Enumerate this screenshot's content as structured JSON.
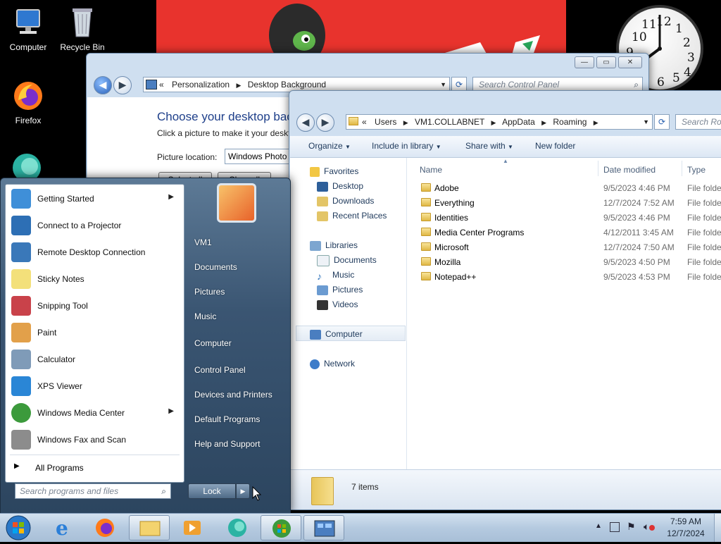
{
  "desktop": {
    "icons": [
      {
        "label": "Computer"
      },
      {
        "label": "Recycle Bin"
      },
      {
        "label": "Firefox"
      }
    ],
    "clock_numbers": [
      "12",
      "1",
      "2",
      "3",
      "4",
      "5",
      "6",
      "9",
      "10",
      "11"
    ]
  },
  "control_panel": {
    "breadcrumb_sep": "«",
    "breadcrumb": [
      "Personalization",
      "Desktop Background"
    ],
    "search_placeholder": "Search Control Panel",
    "heading": "Choose your desktop background",
    "subtext": "Click a picture to make it your desktop background",
    "picture_location_label": "Picture location:",
    "picture_location_value": "Windows Photo Viewer",
    "select_all": "Select all",
    "clear_all": "Clear all"
  },
  "explorer": {
    "breadcrumb_sep": "«",
    "breadcrumb": [
      "Users",
      "VM1.COLLABNET",
      "AppData",
      "Roaming"
    ],
    "search_placeholder": "Search Roaming",
    "toolbar": {
      "organize": "Organize",
      "include": "Include in library",
      "share": "Share with",
      "new_folder": "New folder"
    },
    "nav": {
      "favorites": "Favorites",
      "desktop": "Desktop",
      "downloads": "Downloads",
      "recent": "Recent Places",
      "libraries": "Libraries",
      "documents": "Documents",
      "music": "Music",
      "pictures": "Pictures",
      "videos": "Videos",
      "computer": "Computer",
      "network": "Network"
    },
    "columns": {
      "name": "Name",
      "date": "Date modified",
      "type": "Type"
    },
    "rows": [
      {
        "name": "Adobe",
        "date": "9/5/2023 4:46 PM",
        "type": "File folder"
      },
      {
        "name": "Everything",
        "date": "12/7/2024 7:52 AM",
        "type": "File folder"
      },
      {
        "name": "Identities",
        "date": "9/5/2023 4:46 PM",
        "type": "File folder"
      },
      {
        "name": "Media Center Programs",
        "date": "4/12/2011 3:45 AM",
        "type": "File folder"
      },
      {
        "name": "Microsoft",
        "date": "12/7/2024 7:50 AM",
        "type": "File folder"
      },
      {
        "name": "Mozilla",
        "date": "9/5/2023 4:50 PM",
        "type": "File folder"
      },
      {
        "name": "Notepad++",
        "date": "9/5/2023 4:53 PM",
        "type": "File folder"
      }
    ],
    "status_count": "7 items"
  },
  "start_menu": {
    "programs": [
      {
        "label": "Getting Started",
        "submenu": true,
        "color": "#3f8fd8"
      },
      {
        "label": "Connect to a Projector",
        "submenu": false,
        "color": "#2d6fb5"
      },
      {
        "label": "Remote Desktop Connection",
        "submenu": false,
        "color": "#3a78b9"
      },
      {
        "label": "Sticky Notes",
        "submenu": false,
        "color": "#f3e07a"
      },
      {
        "label": "Snipping Tool",
        "submenu": false,
        "color": "#c9424a"
      },
      {
        "label": "Paint",
        "submenu": false,
        "color": "#e2a04a"
      },
      {
        "label": "Calculator",
        "submenu": false,
        "color": "#7f9bb8"
      },
      {
        "label": "XPS Viewer",
        "submenu": false,
        "color": "#2a86d6"
      },
      {
        "label": "Windows Media Center",
        "submenu": true,
        "color": "#3c9a3c"
      },
      {
        "label": "Windows Fax and Scan",
        "submenu": false,
        "color": "#8c8c8c"
      }
    ],
    "all_programs": "All Programs",
    "search_placeholder": "Search programs and files",
    "right_links": [
      "VM1",
      "Documents",
      "Pictures",
      "Music",
      "Computer",
      "Control Panel",
      "Devices and Printers",
      "Default Programs",
      "Help and Support"
    ],
    "lock": "Lock"
  },
  "taskbar": {
    "time": "7:59 AM",
    "date": "12/7/2024"
  }
}
